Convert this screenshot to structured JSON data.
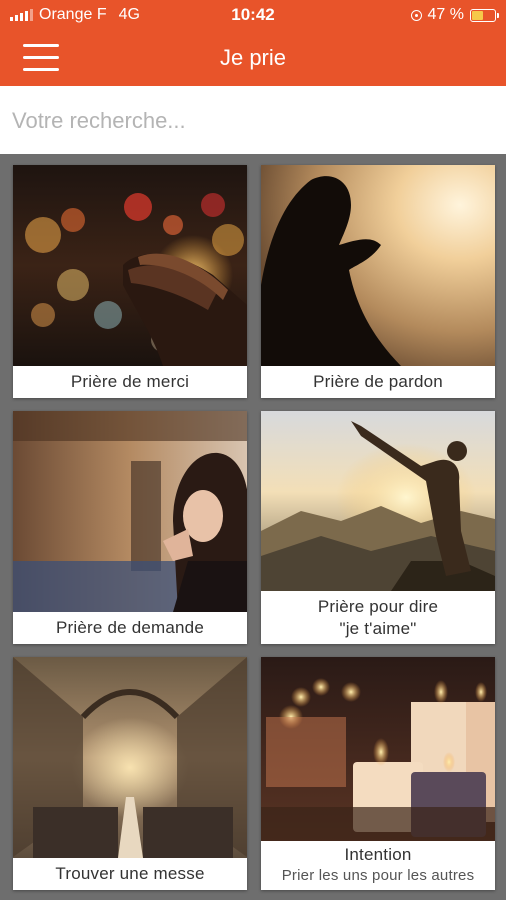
{
  "status_bar": {
    "carrier": "Orange F",
    "network": "4G",
    "time": "10:42",
    "battery": "47 %",
    "battery_level": 0.47
  },
  "header": {
    "title": "Je prie",
    "menu_icon": "hamburger-menu-icon"
  },
  "search": {
    "placeholder": "Votre recherche...",
    "value": ""
  },
  "cards": [
    {
      "label": "Prière de merci"
    },
    {
      "label": "Prière de pardon"
    },
    {
      "label": "Prière de demande"
    },
    {
      "label_line1": "Prière pour dire",
      "label_line2": "\"je t'aime\""
    },
    {
      "label": "Trouver une messe"
    },
    {
      "label": "Intention",
      "sublabel": "Prier les uns pour les autres"
    }
  ],
  "colors": {
    "accent": "#e8542a",
    "background": "#6e6e6e",
    "card": "#ffffff"
  }
}
